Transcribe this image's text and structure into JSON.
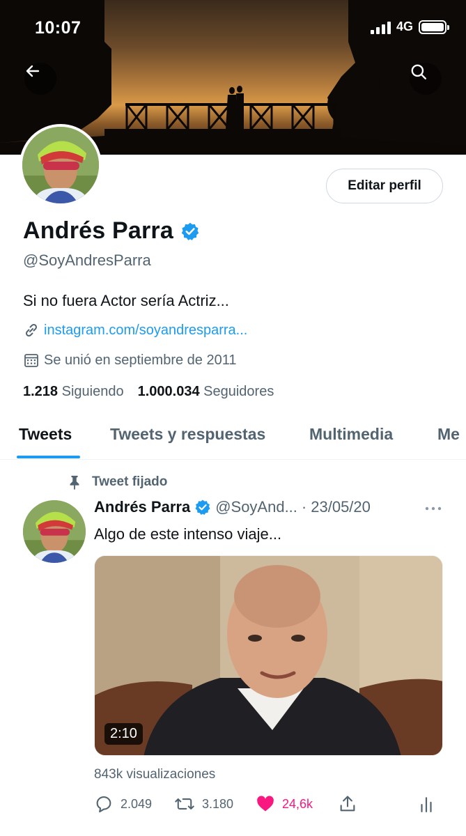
{
  "status_bar": {
    "time": "10:07",
    "network": "4G",
    "battery_level": 1.0
  },
  "header": {
    "back_icon": "arrow-left-icon",
    "search_icon": "search-icon"
  },
  "profile": {
    "edit_label": "Editar perfil",
    "name": "Andrés Parra",
    "verified": true,
    "handle": "@SoyAndresParra",
    "bio": "Si no fuera Actor sería Actriz...",
    "link": "instagram.com/soyandresparra...",
    "joined": "Se unió en septiembre de 2011",
    "following_count": "1.218",
    "following_label": "Siguiendo",
    "followers_count": "1.000.034",
    "followers_label": "Seguidores"
  },
  "tabs": [
    {
      "label": "Tweets",
      "active": true
    },
    {
      "label": "Tweets y respuestas",
      "active": false
    },
    {
      "label": "Multimedia",
      "active": false
    },
    {
      "label": "Me",
      "active": false
    }
  ],
  "tweet": {
    "pinned_label": "Tweet fijado",
    "author_name": "Andrés Parra",
    "author_handle": "@SoyAnd...",
    "dot": "·",
    "date": "23/05/20",
    "text": "Algo de este intenso viaje...",
    "video_duration": "2:10",
    "views": "843k visualizaciones",
    "replies": "2.049",
    "retweets": "3.180",
    "likes": "24,6k",
    "liked": true
  },
  "colors": {
    "accent": "#1d9bf0",
    "like": "#f91880",
    "muted": "#536471",
    "text": "#0f1419"
  }
}
